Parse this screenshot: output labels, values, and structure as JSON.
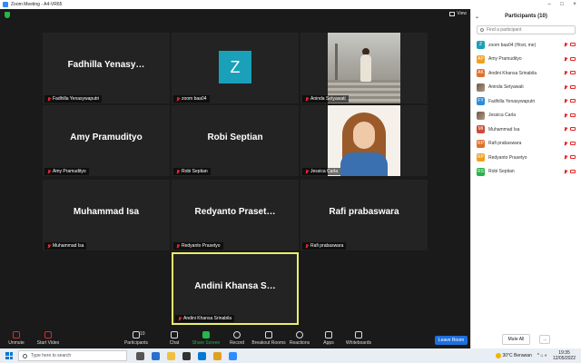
{
  "window": {
    "title": "Zoom Meeting - A4-VR65"
  },
  "meeting": {
    "view_label": "View",
    "tiles": [
      {
        "big_name": "Fadhilla  Yenasy…",
        "name_tag": "Fadhilla Yenasywaputri"
      },
      {
        "avatar_letter": "Z",
        "name_tag": "zoom baa04"
      },
      {
        "name_tag": "Aninda Setyawati"
      },
      {
        "big_name": "Amy Pramudityo",
        "name_tag": "Amy Pramudityo"
      },
      {
        "big_name": "Robi Septian",
        "name_tag": "Robi Septian"
      },
      {
        "name_tag": "Jessica Carla"
      },
      {
        "big_name": "Muhammad Isa",
        "name_tag": "Muhammad Isa"
      },
      {
        "big_name": "Redyanto  Praset…",
        "name_tag": "Redyanto Prasetyo"
      },
      {
        "big_name": "Rafi prabaswara",
        "name_tag": "Rafi prabaswara"
      },
      {
        "big_name": "Andini  Khansa  S…",
        "name_tag": "Andini Khansa Srinabila"
      }
    ]
  },
  "toolbar": {
    "unmute": "Unmute",
    "start_video": "Start Video",
    "participants": "Participants",
    "participants_count": "10",
    "chat": "Chat",
    "share_screen": "Share Screen",
    "record": "Record",
    "breakout_rooms": "Breakout Rooms",
    "reactions": "Reactions",
    "apps": "Apps",
    "whiteboards": "Whiteboards",
    "leave": "Leave Room"
  },
  "panel": {
    "title": "Participants (10)",
    "search_placeholder": "Find a participant",
    "participants": [
      {
        "initials": "Z",
        "name": "zoom baa04 (Host, me)",
        "color": "#1aa0b8"
      },
      {
        "initials": "AP",
        "name": "Amy Pramudityo",
        "color": "#f0a020"
      },
      {
        "initials": "AK",
        "name": "Andini Khansa Srinabila",
        "color": "#e0702a"
      },
      {
        "initials": "",
        "name": "Aninda Setyawati",
        "color": "#7a6a5a"
      },
      {
        "initials": "FY",
        "name": "Fadhilla Yenasywaputri",
        "color": "#2d8cd8"
      },
      {
        "initials": "",
        "name": "Jessica Carla",
        "color": "#b07a5a"
      },
      {
        "initials": "MI",
        "name": "Muhammad Isa",
        "color": "#d04a3a"
      },
      {
        "initials": "RP",
        "name": "Rafi prabaswara",
        "color": "#e0702a"
      },
      {
        "initials": "RP",
        "name": "Redyanto Prasetyo",
        "color": "#f0a020"
      },
      {
        "initials": "RS",
        "name": "Robi Septian",
        "color": "#2bb04a"
      }
    ],
    "mute_all": "Mute All",
    "more": "..."
  },
  "taskbar": {
    "search_placeholder": "Type here to search",
    "weather": "30°C  Berawan",
    "time": "19:35",
    "date": "12/05/2022"
  }
}
